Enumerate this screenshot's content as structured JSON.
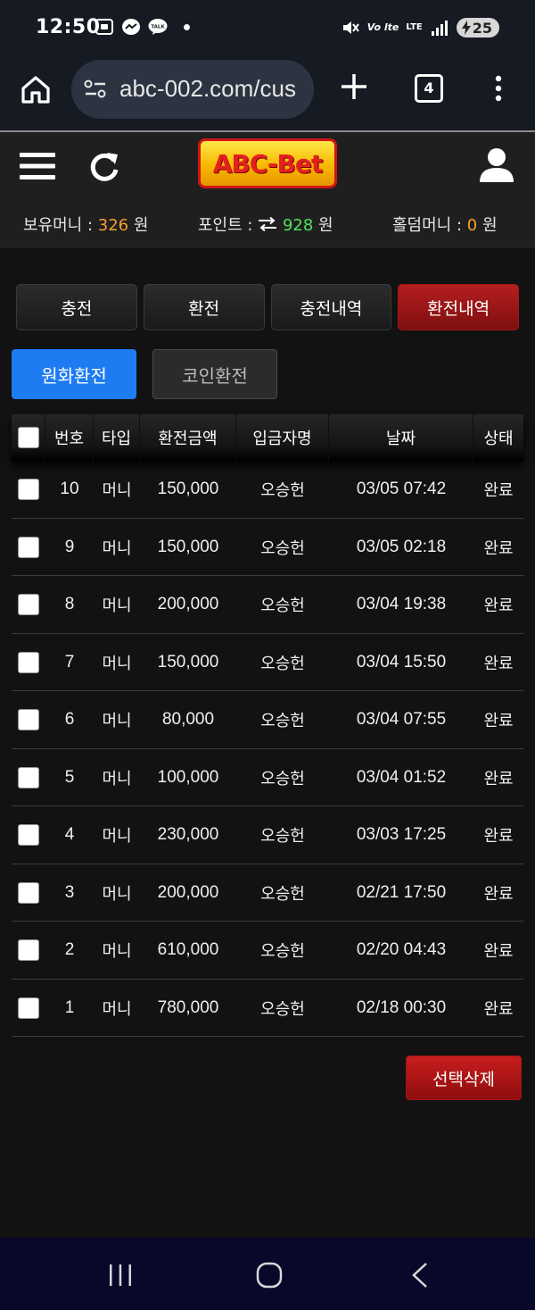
{
  "status_bar": {
    "time": "12:50",
    "battery": "25",
    "lte_top": "LTE",
    "volte": "Vo lte",
    "left_icons": [
      "screenshot-icon",
      "messenger-icon",
      "kakaotalk-icon",
      "dot-icon"
    ],
    "right_icons": [
      "mute-icon",
      "volte-icon",
      "lte-icon",
      "signal-icon",
      "battery-icon"
    ]
  },
  "browser": {
    "url": "abc-002.com/cus",
    "tab_count": "4",
    "icons": [
      "home-icon",
      "site-settings-icon",
      "new-tab-icon",
      "tabs-icon",
      "more-icon"
    ]
  },
  "header": {
    "logo_text": "ABC-Bet",
    "balances": {
      "money_label": "보유머니 :",
      "money_value": "326",
      "money_unit": "원",
      "point_label": "포인트 :",
      "point_value": "928",
      "point_unit": "원",
      "holdem_label": "홀덤머니 :",
      "holdem_value": "0",
      "holdem_unit": "원"
    },
    "colors": {
      "money": "#f6a02b",
      "point": "#4fe05f",
      "holdem": "#f6a02b"
    }
  },
  "tabs": [
    {
      "label": "충전",
      "active": false
    },
    {
      "label": "환전",
      "active": false
    },
    {
      "label": "충전내역",
      "active": false
    },
    {
      "label": "환전내역",
      "active": true
    }
  ],
  "subtabs": [
    {
      "label": "원화환전",
      "active": true
    },
    {
      "label": "코인환전",
      "active": false
    }
  ],
  "table": {
    "headers": [
      "번호",
      "타입",
      "환전금액",
      "입금자명",
      "날짜",
      "상태"
    ],
    "rows": [
      {
        "num": "10",
        "type": "머니",
        "amount": "150,000",
        "name": "오승헌",
        "date": "03/05 07:42",
        "status": "완료"
      },
      {
        "num": "9",
        "type": "머니",
        "amount": "150,000",
        "name": "오승헌",
        "date": "03/05 02:18",
        "status": "완료"
      },
      {
        "num": "8",
        "type": "머니",
        "amount": "200,000",
        "name": "오승헌",
        "date": "03/04 19:38",
        "status": "완료"
      },
      {
        "num": "7",
        "type": "머니",
        "amount": "150,000",
        "name": "오승헌",
        "date": "03/04 15:50",
        "status": "완료"
      },
      {
        "num": "6",
        "type": "머니",
        "amount": "80,000",
        "name": "오승헌",
        "date": "03/04 07:55",
        "status": "완료"
      },
      {
        "num": "5",
        "type": "머니",
        "amount": "100,000",
        "name": "오승헌",
        "date": "03/04 01:52",
        "status": "완료"
      },
      {
        "num": "4",
        "type": "머니",
        "amount": "230,000",
        "name": "오승헌",
        "date": "03/03 17:25",
        "status": "완료"
      },
      {
        "num": "3",
        "type": "머니",
        "amount": "200,000",
        "name": "오승헌",
        "date": "02/21 17:50",
        "status": "완료"
      },
      {
        "num": "2",
        "type": "머니",
        "amount": "610,000",
        "name": "오승헌",
        "date": "02/20 04:43",
        "status": "완료"
      },
      {
        "num": "1",
        "type": "머니",
        "amount": "780,000",
        "name": "오승헌",
        "date": "02/18 00:30",
        "status": "완료"
      }
    ]
  },
  "actions": {
    "delete_selected": "선택삭제"
  },
  "nav_bar": {
    "icons": [
      "recent-apps-icon",
      "home-circle-icon",
      "back-icon"
    ]
  }
}
